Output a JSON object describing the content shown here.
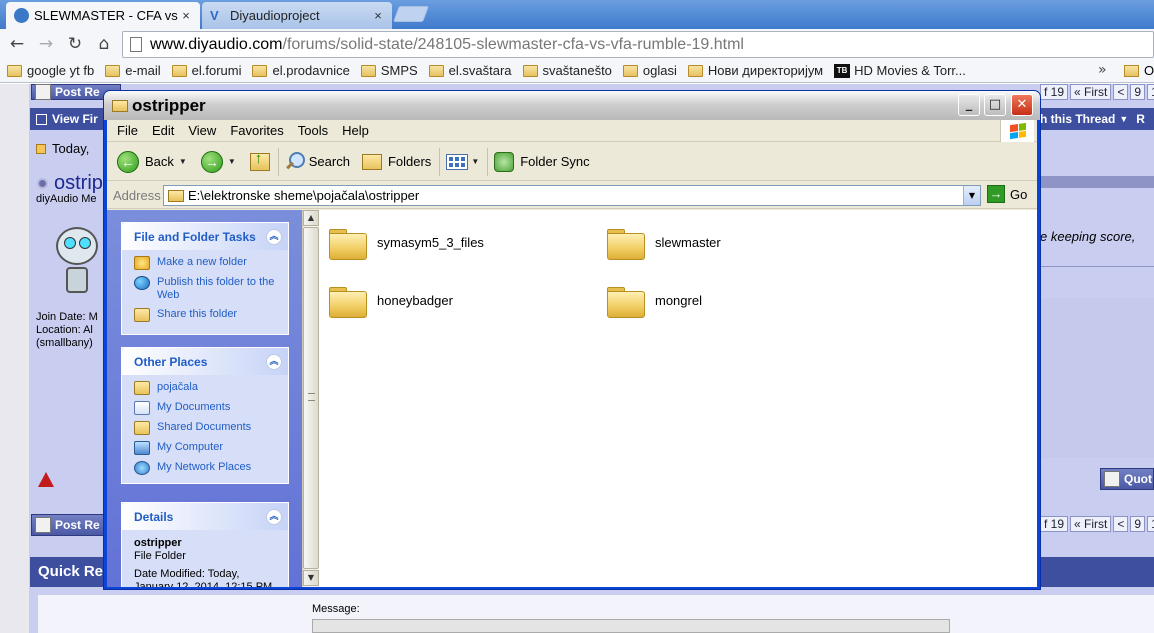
{
  "browser": {
    "tabs": [
      {
        "title": "SLEWMASTER - CFA vs.",
        "active": true
      },
      {
        "title": "Diyaudioproject",
        "active": false
      }
    ],
    "tab_close_glyph": "×",
    "url_host": "www.diyaudio.com",
    "url_path": "/forums/solid-state/248105-slewmaster-cfa-vs-vfa-rumble-19.html",
    "bookmarks": [
      "google yt fb",
      "e-mail",
      "el.forumi",
      "el.prodavnice",
      "SMPS",
      "el.svaštara",
      "svaštanešto",
      "oglasi",
      "Нови директоријум",
      "HD Movies & Torr..."
    ],
    "bookmark_tb_badge": "TB",
    "bookmarks_more": "»",
    "bookmark_last": "O"
  },
  "forum": {
    "post_reply_top": "Post Re",
    "view_first": "View Fir",
    "today": "Today,",
    "username": "ostrip",
    "member_line": "diyAudio Me",
    "join_date": "Join Date: M",
    "location": "Location: Al",
    "smallbany": "(smallbany)",
    "search_thread": "h this Thread",
    "right_edge": "R",
    "post_snippet": "e keeping score,",
    "quote_label": "Quot",
    "post_reply_bottom": "Post Re",
    "quick_reply": "Quick Rep",
    "message_label": "Message:",
    "pager": [
      "f 19",
      "« First",
      "<",
      "9",
      "1"
    ]
  },
  "explorer": {
    "title": "ostripper",
    "menu": [
      "File",
      "Edit",
      "View",
      "Favorites",
      "Tools",
      "Help"
    ],
    "toolbar": {
      "back": "Back",
      "search": "Search",
      "folders": "Folders",
      "folder_sync": "Folder Sync"
    },
    "address_label": "Address",
    "address_value": "E:\\elektronske sheme\\pojačala\\ostripper",
    "go_label": "Go",
    "tasks": {
      "file_folder_title": "File and Folder Tasks",
      "file_folder_items": [
        "Make a new folder",
        "Publish this folder to the Web",
        "Share this folder"
      ],
      "other_places_title": "Other Places",
      "other_places_items": [
        "pojačala",
        "My Documents",
        "Shared Documents",
        "My Computer",
        "My Network Places"
      ],
      "details_title": "Details",
      "details_name": "ostripper",
      "details_type": "File Folder",
      "details_modified": "Date Modified: Today, January 12, 2014, 12:15 PM"
    },
    "files": [
      "symasym5_3_files",
      "slewmaster",
      "honeybadger",
      "mongrel"
    ]
  },
  "colors": {
    "xp_blue": "#0a45d8",
    "forum_bar": "#3e4fa0",
    "task_link": "#215dc6"
  }
}
